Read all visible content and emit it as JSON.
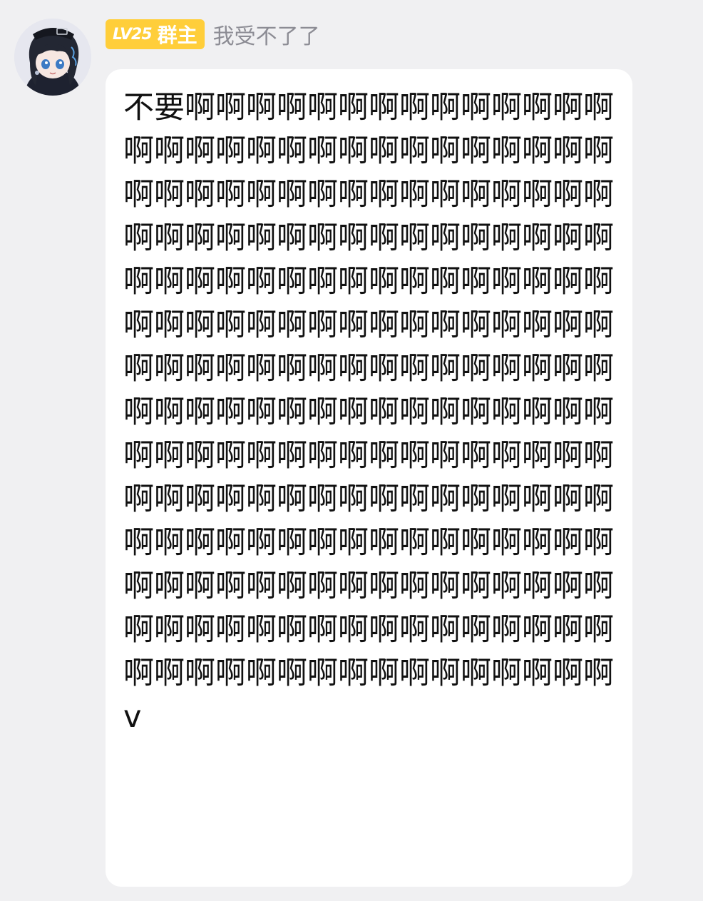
{
  "sender": {
    "level_badge": "LV25",
    "role_badge": "群主",
    "nickname": "我受不了了"
  },
  "message": {
    "text": "不要啊啊啊啊啊啊啊啊啊啊啊啊啊啊啊啊啊啊啊啊啊啊啊啊啊啊啊啊啊啊啊啊啊啊啊啊啊啊啊啊啊啊啊啊啊啊啊啊啊啊啊啊啊啊啊啊啊啊啊啊啊啊啊啊啊啊啊啊啊啊啊啊啊啊啊啊啊啊啊啊啊啊啊啊啊啊啊啊啊啊啊啊啊啊啊啊啊啊啊啊啊啊啊啊啊啊啊啊啊啊啊啊啊啊啊啊啊啊啊啊啊啊啊啊啊啊啊啊啊啊啊啊啊啊啊啊啊啊啊啊啊啊啊啊啊啊啊啊啊啊啊啊啊啊啊啊啊啊啊啊啊啊啊啊啊啊啊啊啊啊啊啊啊啊啊啊啊啊啊啊啊啊啊啊啊啊啊啊啊啊啊啊啊啊啊啊啊啊啊啊啊啊啊啊啊啊啊啊啊啊啊啊啊啊啊啊啊啊啊啊啊啊v"
  },
  "colors": {
    "page_background": "#f0f0f2",
    "bubble_background": "#ffffff",
    "badge_background": "#ffce3a",
    "nickname_text": "#8c8c94",
    "message_text": "#111111"
  }
}
